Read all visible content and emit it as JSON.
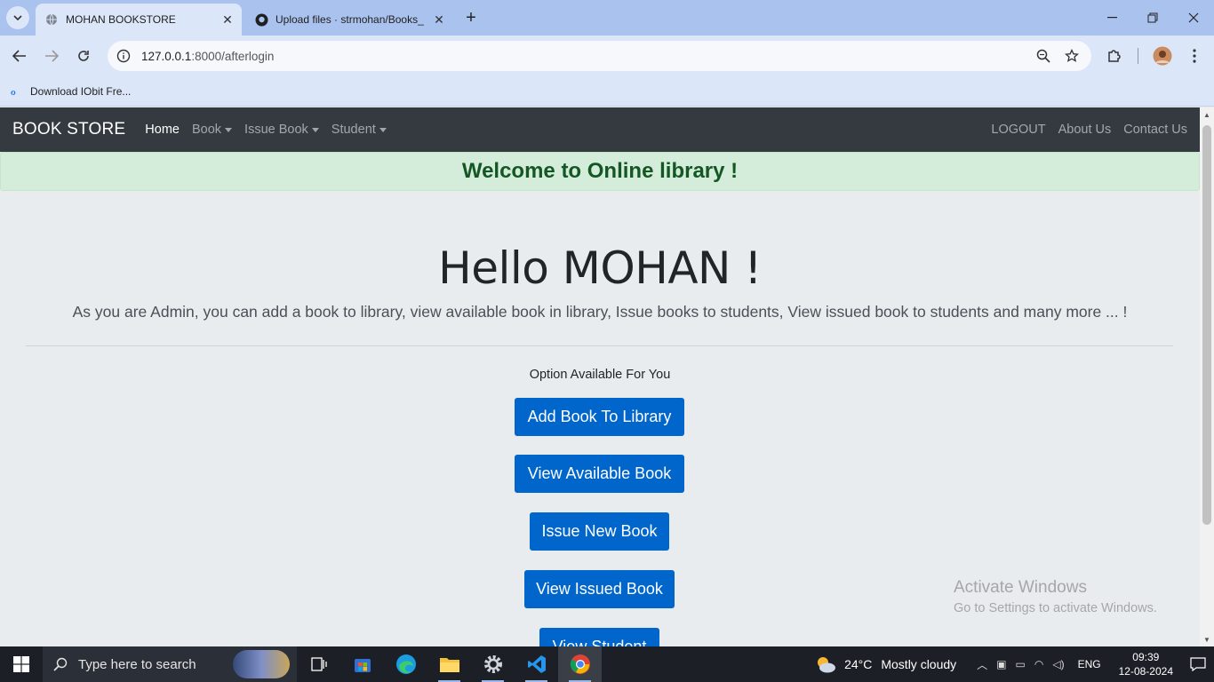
{
  "browser": {
    "tabs": [
      {
        "title": "MOHAN BOOKSTORE",
        "active": true
      },
      {
        "title": "Upload files · strmohan/Books_",
        "active": false
      }
    ],
    "url_host": "127.0.0.1",
    "url_path": ":8000/afterlogin",
    "bookmark": "Download IObit Fre..."
  },
  "navbar": {
    "brand": "BOOK STORE",
    "links": [
      {
        "label": "Home"
      },
      {
        "label": "Book"
      },
      {
        "label": "Issue Book"
      },
      {
        "label": "Student"
      }
    ],
    "right_links": [
      {
        "label": "LOGOUT"
      },
      {
        "label": "About Us"
      },
      {
        "label": "Contact Us"
      }
    ]
  },
  "alert": "Welcome to Online library !",
  "jumbotron": {
    "greeting": "Hello MOHAN !",
    "lead": "As you are Admin, you can add a book to library, view available book in library, Issue books to students, View issued book to students and many more ... !"
  },
  "options": {
    "title": "Option Available For You",
    "buttons": [
      {
        "label": "Add Book To Library"
      },
      {
        "label": "View Available Book"
      },
      {
        "label": "Issue New Book"
      },
      {
        "label": "View Issued Book"
      },
      {
        "label": "View Student"
      }
    ]
  },
  "watermark": {
    "line1": "Activate Windows",
    "line2": "Go to Settings to activate Windows."
  },
  "taskbar": {
    "search_placeholder": "Type here to search",
    "weather_temp": "24°C",
    "weather_desc": "Mostly cloudy",
    "language": "ENG",
    "time": "09:39",
    "date": "12-08-2024"
  },
  "colors": {
    "navbar_bg": "#343a40",
    "alert_bg": "#d4edda",
    "alert_text": "#155724",
    "button_bg": "#0066cc"
  }
}
